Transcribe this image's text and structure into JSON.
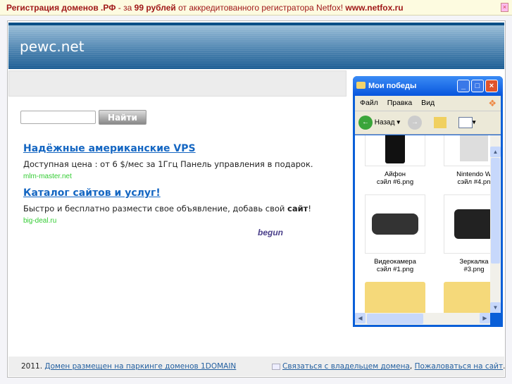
{
  "banner": {
    "part1": "Регистрация доменов .РФ",
    "part2": " - за ",
    "part3": "99 рублей",
    "part4": " от аккредитованного регистратора Netfox! ",
    "part5": "www.netfox.ru"
  },
  "site_title": "pewc.net",
  "search": {
    "value": "",
    "button": "Найти"
  },
  "ads": [
    {
      "title": "Надёжные американские VPS",
      "text": "Доступная цена : от 6 $/мес за 1Ггц Панель управления в подарок.",
      "url": "mlm-master.net"
    },
    {
      "title": "Каталог сайтов и услуг!",
      "text": "Быстро и бесплатно размести свое объявление, добавь свой ",
      "bold": "сайт",
      "end": "!",
      "url": "big-deal.ru"
    }
  ],
  "ad_network": "begun",
  "footer": {
    "year": "2011.",
    "parking_link": "Домен размещен на паркинге доменов 1DOMAIN",
    "contact_link": "Связаться с владельцем домена",
    "sep": ",",
    "complain_link": "Пожаловаться на сайт",
    "end": "."
  },
  "window": {
    "title": "Мои победы",
    "menu": [
      "Файл",
      "Правка",
      "Вид"
    ],
    "back": "Назад",
    "items": [
      {
        "l1": "Айфон",
        "l2": "сэйл #6.png"
      },
      {
        "l1": "Nintendo W",
        "l2": "сэйл #4.pn"
      },
      {
        "l1": "Видеокамера",
        "l2": "сэйл #1.png"
      },
      {
        "l1": "Зеркалка",
        "l2": "#3.png"
      }
    ]
  }
}
